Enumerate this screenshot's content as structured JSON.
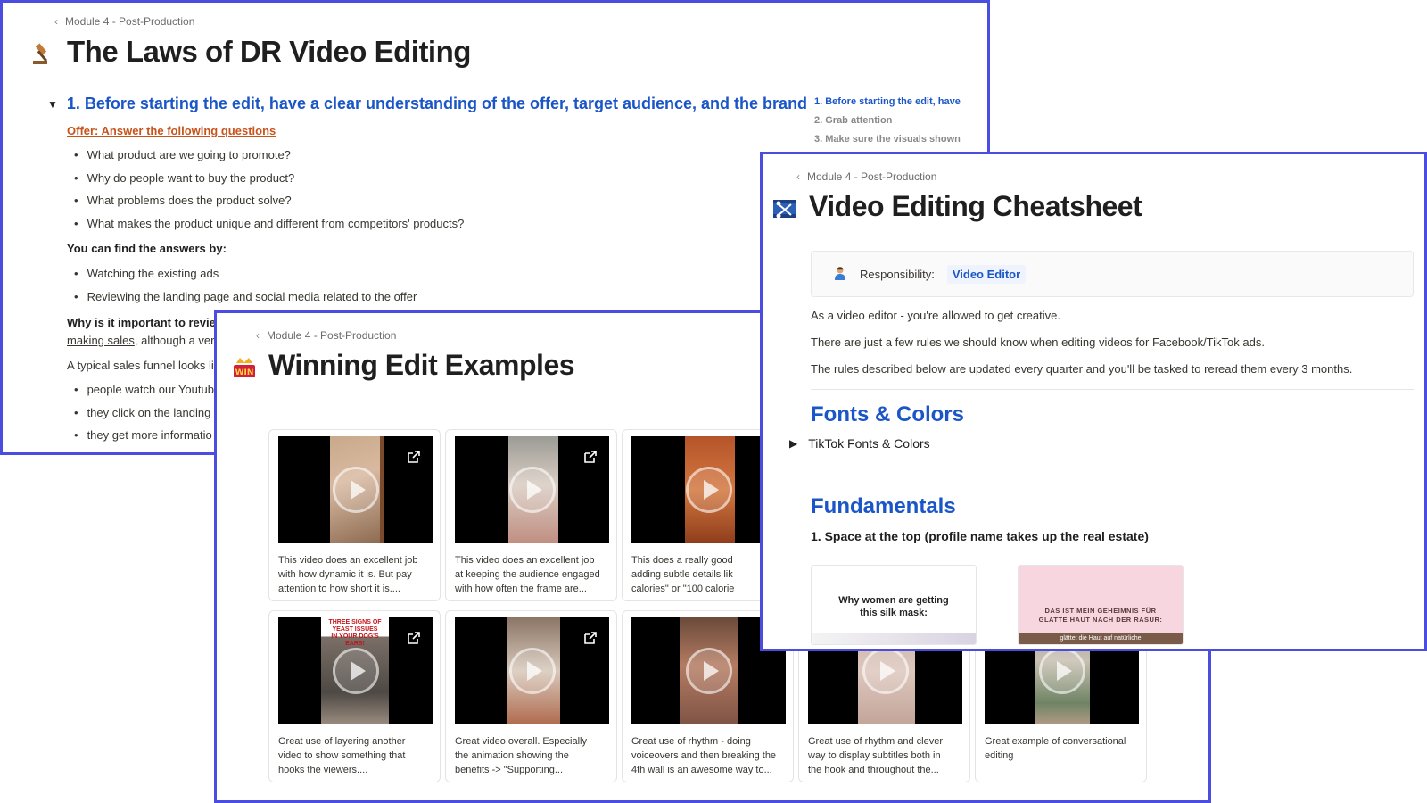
{
  "window1": {
    "breadcrumb": "Module 4 - Post-Production",
    "title": "The Laws of DR Video Editing",
    "icon": "gavel-icon",
    "section_heading": "1. Before starting the edit, have a clear understanding of the offer, target audience, and the brand",
    "offer_link": "Offer: Answer the following questions",
    "questions": [
      "What product are we going to promote?",
      "Why do people want to buy the product?",
      "What problems does the product solve?",
      "What makes the product unique and different from competitors' products?"
    ],
    "find_answers_label": "You can find the answers by:",
    "find_answers": [
      "Watching the existing ads",
      "Reviewing the landing page and social media related to the offer"
    ],
    "why_label": "Why is it important to reviev",
    "why_link": "making sales",
    "why_rest": ", although a ver",
    "funnel_intro": "A typical sales funnel looks li",
    "funnel": [
      "people watch our Youtub",
      "they click on the landing",
      "they get more informatio"
    ],
    "toc": [
      "1. Before starting the edit, have",
      "2. Grab attention",
      "3. Make sure the visuals shown"
    ]
  },
  "window2": {
    "breadcrumb": "Module 4 - Post-Production",
    "title": "Winning Edit Examples",
    "icon": "win-trophy-icon",
    "badge": "WIN",
    "cards": [
      {
        "desc": "This video does an excellent job\nwith how dynamic it is. But pay\nattention to how short it is...."
      },
      {
        "desc": "This video does an excellent job\nat keeping the audience engaged\nwith how often the frame are..."
      },
      {
        "desc": "This does a really good\nadding subtle details lik\ncalories\" or \"100 calorie"
      },
      {
        "desc": "Great use of layering another\nvideo to show something that\nhooks the viewers....",
        "overlay": "THREE SIGNS OF YEAST ISSUES\nIN YOUR DOG'S EARS!"
      },
      {
        "desc": "Great video overall. Especially\nthe animation showing the\nbenefits -> \"Supporting..."
      },
      {
        "desc": "Great use of rhythm - doing\nvoiceovers and then breaking the\n4th wall is an awesome way to..."
      },
      {
        "desc": "Great use of rhythm and clever\nway to display subtitles both in\nthe hook and throughout the..."
      },
      {
        "desc": "Great example of conversational\nediting"
      }
    ]
  },
  "window3": {
    "breadcrumb": "Module 4 - Post-Production",
    "title": "Video Editing Cheatsheet",
    "icon": "film-scissors-icon",
    "responsibility_label": "Responsibility:",
    "responsibility_value": "Video Editor",
    "paragraphs": [
      "As a video editor - you're allowed to get creative.",
      "There are just a few rules we should know when editing videos for Facebook/TikTok ads.",
      "The rules described below are updated every quarter and you'll be tasked to reread them every 3 months."
    ],
    "fonts_heading": "Fonts & Colors",
    "fonts_toggle": "TikTok Fonts & Colors",
    "fundamentals_heading": "Fundamentals",
    "rule1": "1. Space at the top (profile name takes up the real estate)",
    "example1_text": "Why women are getting\nthis silk mask:",
    "example2_text": "DAS IST MEIN GEHEIMNIS FÜR\nGLATTE HAUT NACH DER RASUR:",
    "example2_caption": "glättet die Haut auf natürliche"
  },
  "colors": {
    "border": "#4a4de0",
    "link_blue": "#1a56c7",
    "offer_orange": "#c8541c"
  }
}
